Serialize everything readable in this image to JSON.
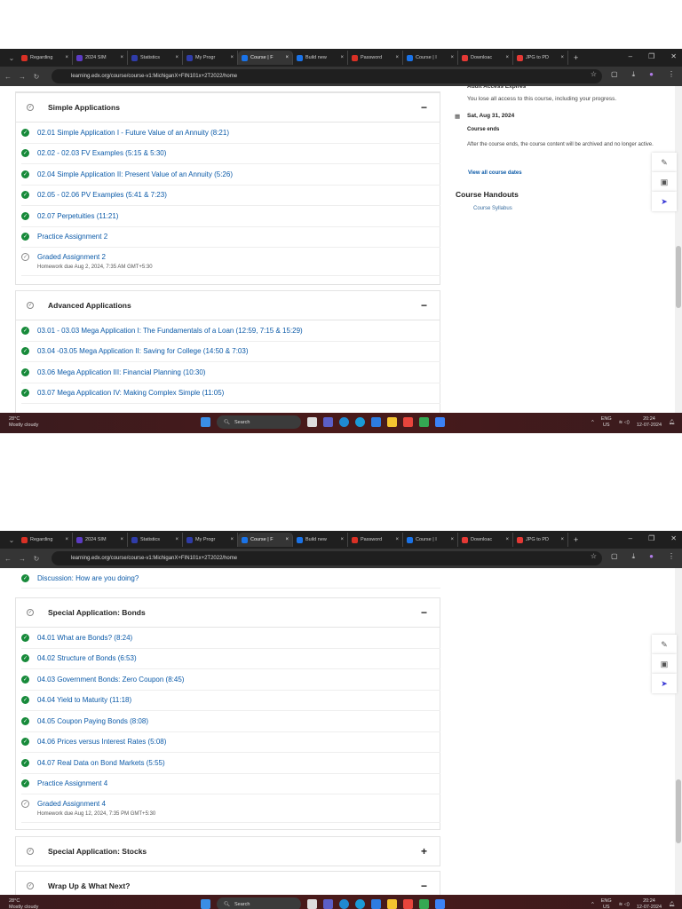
{
  "browser": {
    "tabs": [
      "Regarding",
      "2024 SIM",
      "Statistics",
      "My Progr",
      "Course | F",
      "Build new",
      "Password",
      "Course | I",
      "Downloac",
      "JPG to PD"
    ],
    "active_tab": 4,
    "url": "learning.edx.org/course/course-v1:MichiganX+FIN101x+2T2022/home"
  },
  "taskbar": {
    "temp": "28°C",
    "weather": "Mostly cloudy",
    "search": "Search",
    "lang": "ENG",
    "region": "US",
    "time": "20:24",
    "date": "12-07-2024"
  },
  "shot1": {
    "sidebar": {
      "partial_heading": "Audit Access Expires",
      "access_text": "You lose all access to this course, including your progress.",
      "date": "Sat, Aug 31, 2024",
      "course_ends": "Course ends",
      "ends_text": "After the course ends, the course content will be archived and no longer active.",
      "view_dates": "View all course dates",
      "handouts_title": "Course Handouts",
      "syllabus": "Course Syllabus"
    },
    "sections": [
      {
        "title": "Simple Applications",
        "toggle": "−",
        "items": [
          {
            "label": "02.01 Simple Application I - Future Value of an Annuity (8:21)",
            "done": true
          },
          {
            "label": "02.02 - 02.03 FV Examples (5:15 & 5:30)",
            "done": true
          },
          {
            "label": "02.04 Simple Application II: Present Value of an Annuity (5:26)",
            "done": true
          },
          {
            "label": "02.05 - 02.06 PV Examples (5:41 & 7:23)",
            "done": true
          },
          {
            "label": "02.07 Perpetuities (11:21)",
            "done": true
          },
          {
            "label": "Practice Assignment 2",
            "done": true
          },
          {
            "label": "Graded Assignment 2",
            "done": false,
            "due": "Homework due Aug 2, 2024, 7:35 AM GMT+5:30"
          }
        ]
      },
      {
        "title": "Advanced Applications",
        "toggle": "−",
        "items": [
          {
            "label": "03.01 - 03.03 Mega Application I: The Fundamentals of a Loan (12:59, 7:15 & 15:29)",
            "done": true
          },
          {
            "label": "03.04 -03.05 Mega Application II: Saving for College (14:50 & 7:03)",
            "done": true
          },
          {
            "label": "03.06 Mega Application III: Financial Planning (10:30)",
            "done": true
          },
          {
            "label": "03.07 Mega Application IV: Making Complex Simple (11:05)",
            "done": true
          }
        ]
      }
    ]
  },
  "shot2": {
    "discussion": "Discussion: How are you doing?",
    "sections": [
      {
        "title": "Special Application: Bonds",
        "toggle": "−",
        "items": [
          {
            "label": "04.01 What are Bonds? (8:24)",
            "done": true
          },
          {
            "label": "04.02 Structure of Bonds (6:53)",
            "done": true
          },
          {
            "label": "04.03 Government Bonds: Zero Coupon (8:45)",
            "done": true
          },
          {
            "label": "04.04 Yield to Maturity (11:18)",
            "done": true
          },
          {
            "label": "04.05 Coupon Paying Bonds (8:08)",
            "done": true
          },
          {
            "label": "04.06 Prices versus Interest Rates (5:08)",
            "done": true
          },
          {
            "label": "04.07 Real Data on Bond Markets (5:55)",
            "done": true
          },
          {
            "label": "Practice Assignment 4",
            "done": true
          },
          {
            "label": "Graded Assignment 4",
            "done": false,
            "due": "Homework due Aug 12, 2024, 7:35 PM GMT+5:30"
          }
        ]
      },
      {
        "title": "Special Application: Stocks",
        "toggle": "+",
        "items": []
      },
      {
        "title": "Wrap Up & What Next?",
        "toggle": "−",
        "items": []
      }
    ]
  }
}
